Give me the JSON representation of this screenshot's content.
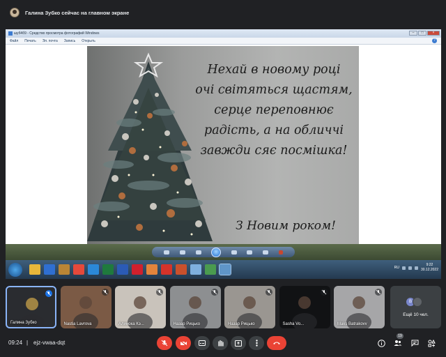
{
  "notification": {
    "text": "Галина Зубко сейчас на главном экране"
  },
  "shared_screen": {
    "window_title": "шуб4б9 - Средство просмотра фотографий Windows",
    "menu": [
      "Файл",
      "Печать",
      "Эл. почта",
      "Запись",
      "Открыть"
    ],
    "card_text_lines": [
      "Нехай в новому році",
      "очі світяться щастям,",
      "серце переповнює",
      "радість, а на обличчі",
      "завжди сяє посмішка!"
    ],
    "card_footer": "З Новим роком!",
    "tray": {
      "lang": "RU",
      "time": "9:22",
      "date": "30.12.2022"
    },
    "taskbar_icons": [
      {
        "name": "explorer-icon",
        "color": "#e8b73a"
      },
      {
        "name": "media-player-icon",
        "color": "#2f6fd1"
      },
      {
        "name": "folder-icon",
        "color": "#b98535"
      },
      {
        "name": "chrome-icon",
        "color": "#e5493b"
      },
      {
        "name": "internet-explorer-icon",
        "color": "#2b88d8"
      },
      {
        "name": "excel-icon",
        "color": "#1f7a3d"
      },
      {
        "name": "word-icon",
        "color": "#2b5bb5"
      },
      {
        "name": "opera-icon",
        "color": "#d0202d"
      },
      {
        "name": "paint-icon",
        "color": "#e2843c"
      },
      {
        "name": "acrobat-icon",
        "color": "#d4332a"
      },
      {
        "name": "powerpoint-icon",
        "color": "#c9502c"
      },
      {
        "name": "photo-viewer-icon",
        "color": "#7fb0de"
      },
      {
        "name": "chrome-2-icon",
        "color": "#4a9b4f"
      },
      {
        "name": "photo-viewer-active-icon",
        "color": "#5f95c8"
      }
    ]
  },
  "participants": [
    {
      "name": "Галина Зубко",
      "bg": "#2a2c30",
      "self": true
    },
    {
      "name": "Nastia Lavrova",
      "bg": "#7b5a45"
    },
    {
      "name": "Алинока Кэ...",
      "bg": "#c9c3bb"
    },
    {
      "name": "Назар Рицько",
      "bg": "#8d8f91"
    },
    {
      "name": "Назар Рицько",
      "bg": "#9a9691"
    },
    {
      "name": "Sasha Vo...",
      "bg": "#111214"
    },
    {
      "name": "Maks Batrakovv",
      "bg": "#a6a6a8"
    }
  ],
  "more_participants": {
    "label": "Ещё 10 чел.",
    "avatars": [
      {
        "letter": "В",
        "color": "#7986cb"
      },
      {
        "letter": "",
        "color": "#5f6368"
      }
    ]
  },
  "bottom_bar": {
    "time": "09:24",
    "separator": "|",
    "meeting_code": "ejz-vwaa-dqt",
    "people_count": "19"
  },
  "colors": {
    "accent": "#8ab4f8",
    "danger": "#ea4335",
    "panel": "#3c4043",
    "background": "#202124"
  }
}
